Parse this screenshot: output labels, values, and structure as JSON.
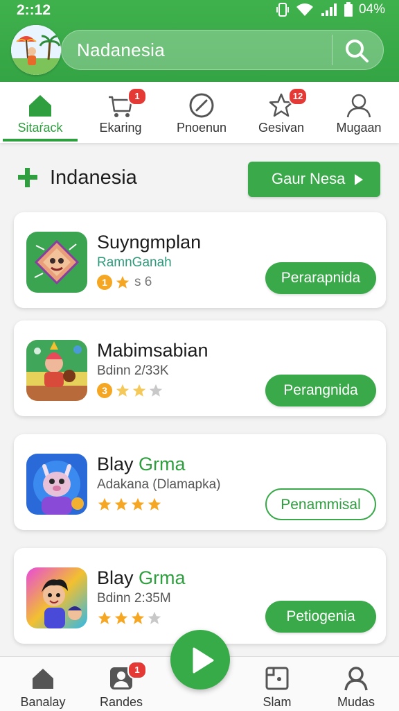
{
  "status_bar": {
    "time": "2::12",
    "battery": "04%"
  },
  "search": {
    "text": "Nadanesia"
  },
  "tabs": [
    {
      "label": "Sitaŕack",
      "icon": "home-icon",
      "active": true
    },
    {
      "label": "Ekaring",
      "icon": "cart-icon",
      "badge": "1"
    },
    {
      "label": "Pnoenun",
      "icon": "block-icon"
    },
    {
      "label": "Gesivan",
      "icon": "star-icon",
      "badge": "12"
    },
    {
      "label": "Mugaan",
      "icon": "profile-icon"
    }
  ],
  "section": {
    "title": "Indanesia",
    "button_label": "Gaur Nesa"
  },
  "cards": [
    {
      "title": "Suyngmplan",
      "title_accent": "",
      "subtitle": "RamnGanah",
      "rank": "1",
      "stars": 1,
      "meta_text": "ѕ 6",
      "button": "Perarapnida",
      "button_style": "filled"
    },
    {
      "title": "Mabimsabian",
      "title_accent": "",
      "subtitle": "Bdinn 2/33K",
      "rank": "3",
      "stars": 2,
      "meta_text": "",
      "button": "Perangnida",
      "button_style": "filled"
    },
    {
      "title": "Blay ",
      "title_accent": "Grma",
      "subtitle": "Adakana (Dlamapka)",
      "rank": "",
      "stars": 4,
      "meta_text": "",
      "button": "Penammisal",
      "button_style": "outline"
    },
    {
      "title": "Blay ",
      "title_accent": "Grma",
      "subtitle": "Bdinn 2:35M",
      "rank": "",
      "stars": 3,
      "meta_text": "",
      "button": "Petiogenia",
      "button_style": "filled"
    }
  ],
  "bottom_nav": [
    {
      "label": "Banalay",
      "icon": "home-icon"
    },
    {
      "label": "Randes",
      "icon": "contacts-icon",
      "badge": "1"
    },
    {
      "label": "Slam",
      "icon": "screen-icon"
    },
    {
      "label": "Mudas",
      "icon": "profile-icon"
    }
  ],
  "colors": {
    "brand_green": "#3aa94a",
    "badge_red": "#e53935",
    "star_gold": "#f5a623"
  }
}
